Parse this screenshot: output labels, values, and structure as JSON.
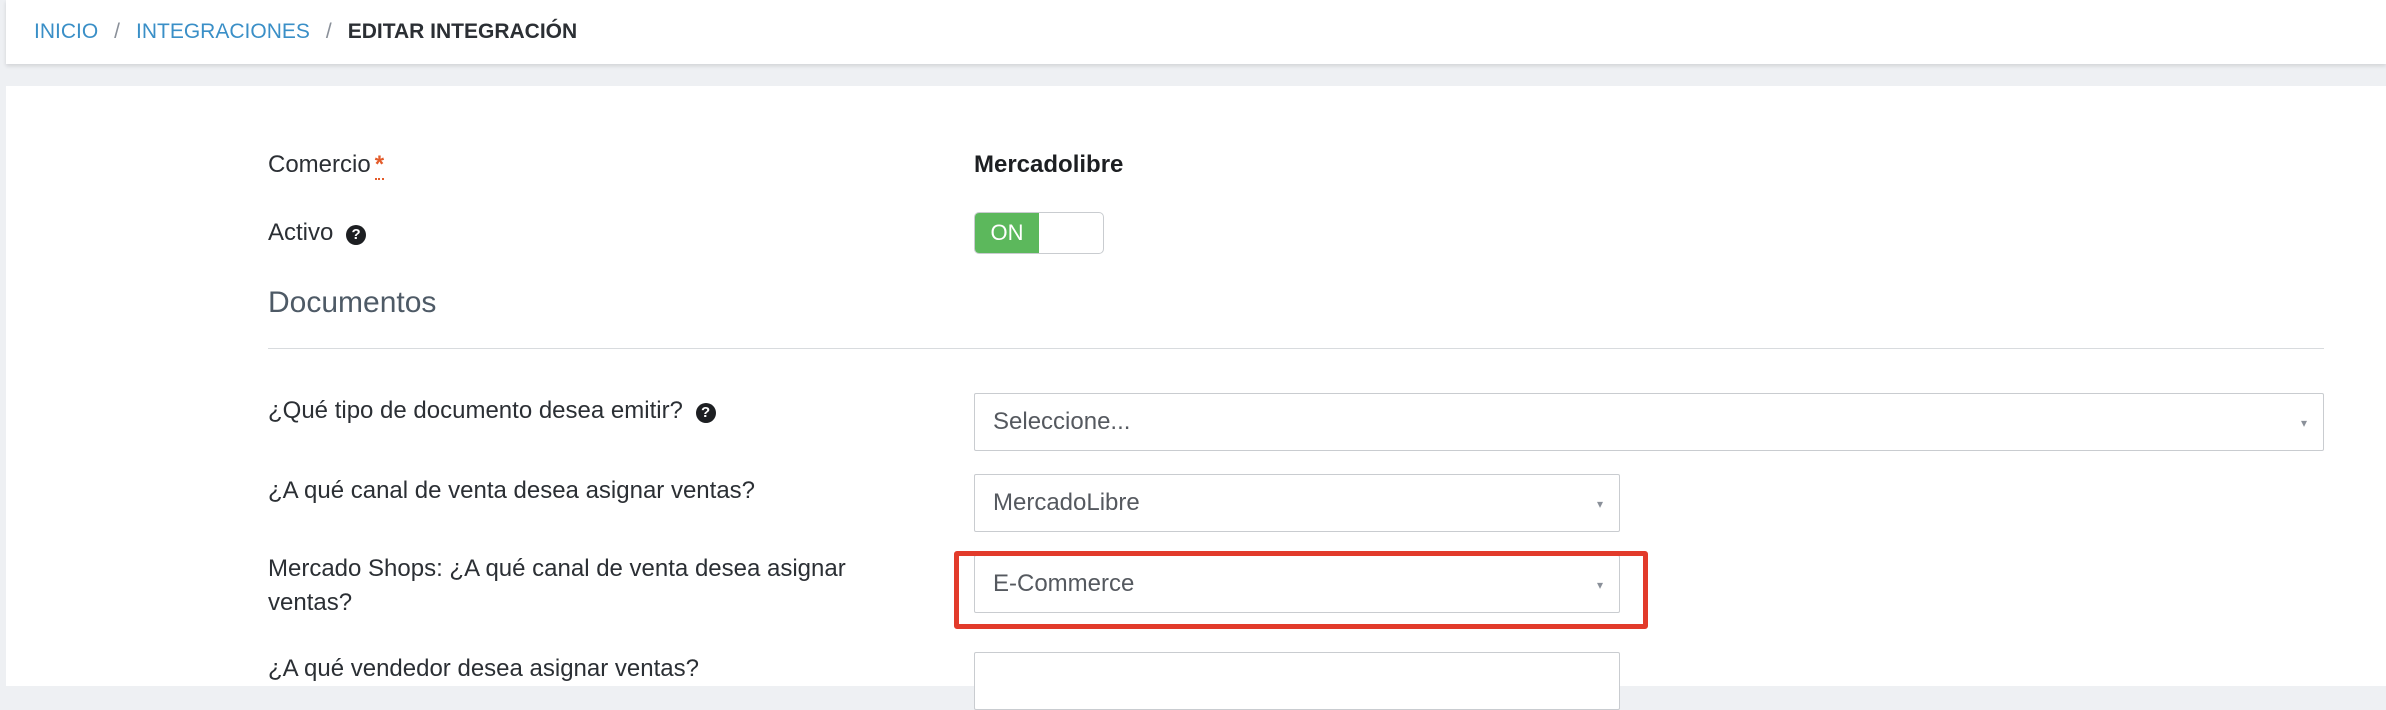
{
  "breadcrumb": {
    "home": "INICIO",
    "integrations": "INTEGRACIONES",
    "current": "EDITAR INTEGRACIÓN",
    "separator": "/"
  },
  "form": {
    "comercio_label": "Comercio",
    "required_mark": "*",
    "comercio_value": "Mercadolibre",
    "activo_label": "Activo",
    "activo_toggle": "ON",
    "section_documentos": "Documentos",
    "doc_type_label": "¿Qué tipo de documento desea emitir?",
    "doc_type_value": "Seleccione...",
    "channel_label": "¿A qué canal de venta desea asignar ventas?",
    "channel_value": "MercadoLibre",
    "shops_label_line1": "Mercado Shops: ¿A qué canal de venta desea asignar",
    "shops_label_line2": "ventas?",
    "shops_value": "E-Commerce",
    "seller_label": "¿A qué vendedor desea asignar ventas?"
  },
  "icons": {
    "help": "question-circle-icon",
    "dropdown": "caret-icon"
  },
  "colors": {
    "link": "#3a8fc7",
    "toggle_on": "#5cb85c",
    "highlight": "#e23b2b",
    "required": "#e35b2a"
  }
}
